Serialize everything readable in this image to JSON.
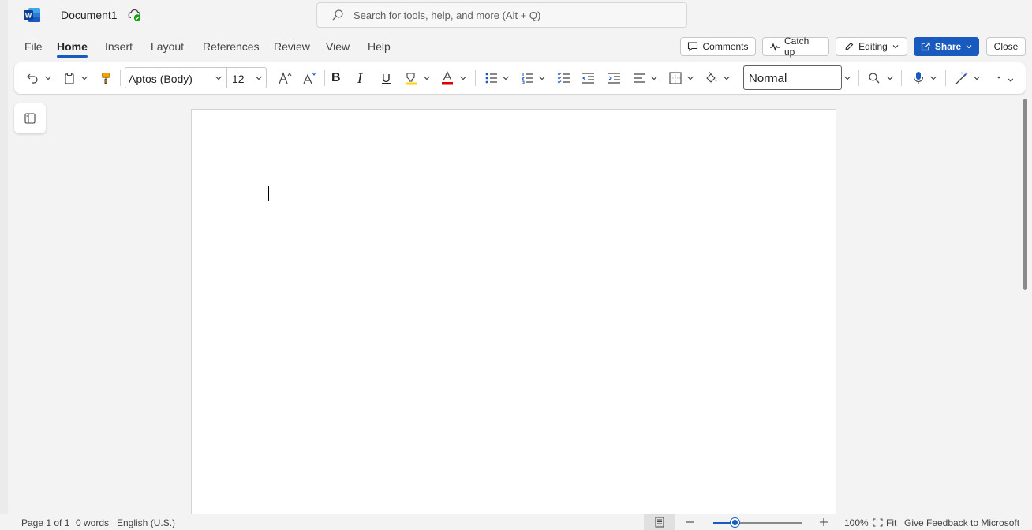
{
  "app": {
    "name": "Word",
    "logo_letter": "W",
    "document_title": "Document1",
    "save_status_icon": "cloud-check-icon"
  },
  "search": {
    "placeholder": "Search for tools, help, and more (Alt + Q)",
    "value": ""
  },
  "menu": {
    "tabs": [
      {
        "label": "File",
        "active": false
      },
      {
        "label": "Home",
        "active": true
      },
      {
        "label": "Insert",
        "active": false
      },
      {
        "label": "Layout",
        "active": false
      },
      {
        "label": "References",
        "active": false
      },
      {
        "label": "Review",
        "active": false
      },
      {
        "label": "View",
        "active": false
      },
      {
        "label": "Help",
        "active": false
      }
    ]
  },
  "header_buttons": {
    "comments": "Comments",
    "catch_up": "Catch up",
    "editing": "Editing",
    "share": "Share",
    "close": "Close"
  },
  "ribbon": {
    "font_name": "Aptos (Body)",
    "font_size": "12",
    "style": "Normal",
    "icons": [
      "undo-icon",
      "clipboard-paste-icon",
      "format-painter-icon",
      "grow-font-icon",
      "shrink-font-icon",
      "bold-icon",
      "italic-icon",
      "underline-icon",
      "highlight-icon",
      "font-color-icon",
      "bullets-icon",
      "numbering-icon",
      "checklist-icon",
      "decrease-indent-icon",
      "increase-indent-icon",
      "align-icon",
      "borders-icon",
      "shading-icon",
      "find-icon",
      "dictate-icon",
      "designer-icon",
      "more-icon"
    ],
    "bold_glyph": "B",
    "italic_glyph": "I",
    "underline_glyph": "U",
    "font_color_glyph": "A"
  },
  "status": {
    "page": "Page 1 of 1",
    "words": "0 words",
    "language": "English (U.S.)",
    "zoom_percent": "100%",
    "zoom_level": 0.24,
    "fit": "Fit",
    "feedback": "Give Feedback to Microsoft"
  },
  "colors": {
    "accent": "#185abd",
    "highlight": "#ffd400",
    "font_color": "#e00000",
    "format_painter": "#f0a400"
  }
}
